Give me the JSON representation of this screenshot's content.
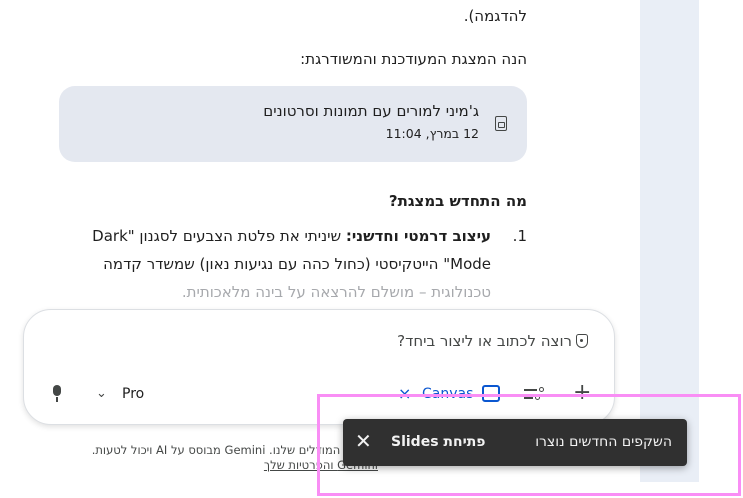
{
  "conversation": {
    "intro_tail": "להדגמה).",
    "intro_line": "הנה המצגת המעודכנת והמשודרגת:",
    "file_card": {
      "title": "ג'מיני למורים עם תמונות וסרטונים",
      "date": "12 במרץ, 11:04",
      "icon": "slides-file-icon"
    },
    "section_heading": "מה התחדש במצגת?",
    "list_item": {
      "number": "1.",
      "bold_label": "עיצוב דרמטי וחדשני:",
      "line1_rest": " שיניתי את פלטת הצבעים לסגנון \"Dark",
      "line2": "Mode\" הייטקיסטי (כחול כהה עם נגיעות נאון) שמשדר קדמה",
      "line3": "טכנולוגית – מושלם להרצאה על בינה מלאכותית."
    }
  },
  "input": {
    "placeholder": "רוצה לכתוב או ליצור ביחד?",
    "model_label": "Pro",
    "canvas_label": "Canvas",
    "icons": [
      "shield-icon",
      "mic-icon",
      "chevron-down-icon",
      "close-icon",
      "canvas-icon",
      "tools-icon",
      "plus-icon"
    ]
  },
  "footer": {
    "line1": "לשיפור המודלים שלנו. Gemini מבוסס על AI ויכול לטעות.",
    "line2": "Gemini והפרטיות שלך"
  },
  "toast": {
    "message": "השקפים החדשים נוצרו",
    "action": "פתיחת Slides",
    "close": "✕"
  },
  "colors": {
    "accent": "#0b57d0",
    "card_bg": "#e4e8f0",
    "toast_bg": "#303030",
    "highlight": "#f98ef5",
    "side_strip": "#e9eef6"
  }
}
